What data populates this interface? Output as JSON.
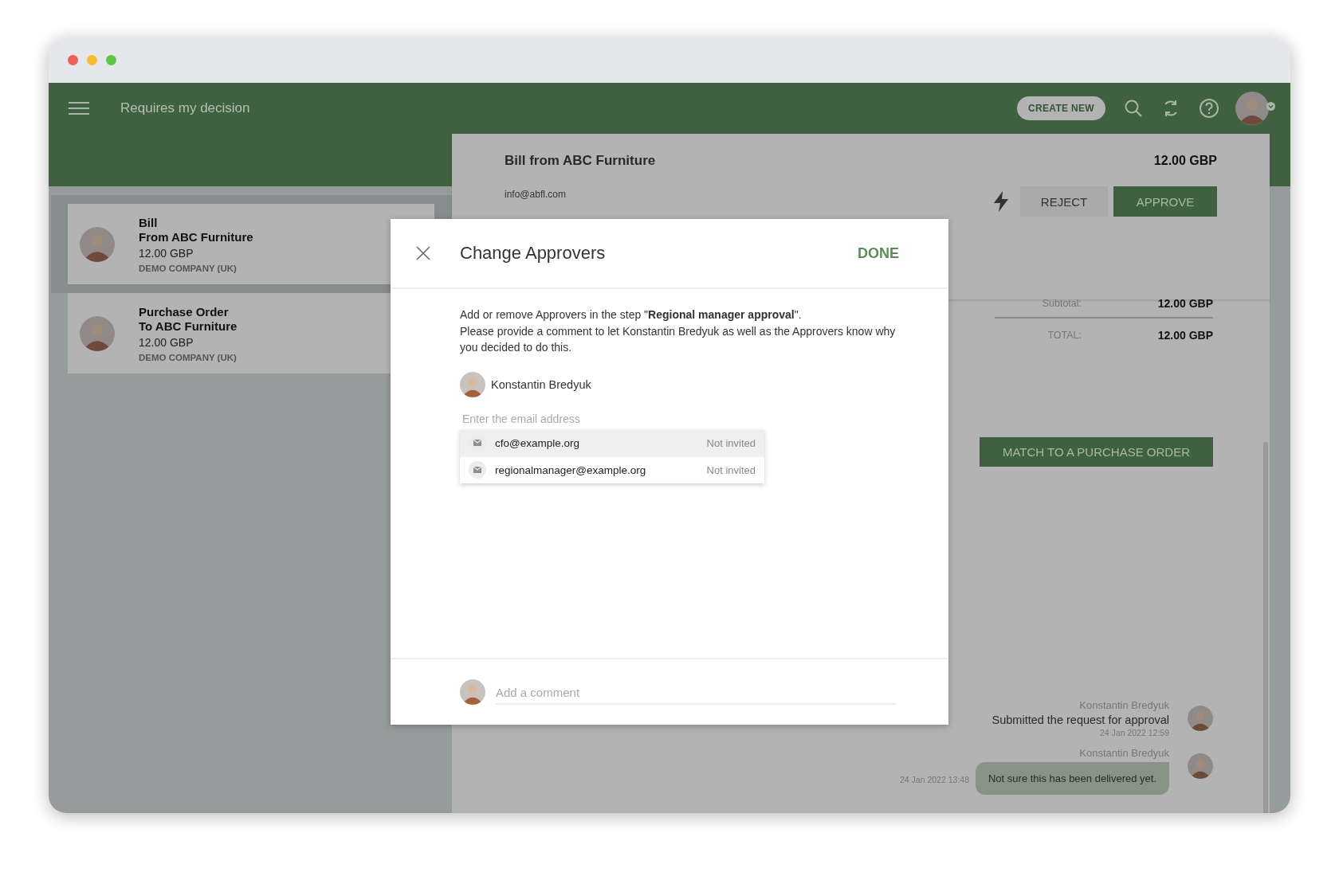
{
  "top_bar": {
    "title": "Requires my decision",
    "create_button": "CREATE NEW"
  },
  "sidebar": {
    "items": [
      {
        "type": "Bill",
        "party": "From ABC Furniture",
        "amount": "12.00 GBP",
        "company": "DEMO COMPANY (UK)",
        "selected": true
      },
      {
        "type": "Purchase Order",
        "party": "To ABC Furniture",
        "amount": "12.00 GBP",
        "company": "DEMO COMPANY (UK)",
        "selected": false
      }
    ]
  },
  "detail": {
    "title": "Bill from ABC Furniture",
    "amount": "12.00 GBP",
    "email": "info@abfl.com",
    "reject_button": "REJECT",
    "approve_button": "APPROVE",
    "totals": [
      {
        "kind": "subtotal",
        "label": "Subtotal:",
        "value": "12.00 GBP"
      },
      {
        "kind": "total",
        "label": "TOTAL:",
        "value": "12.00 GBP"
      }
    ],
    "match_button": "MATCH TO A PURCHASE ORDER",
    "activity": [
      {
        "kind": "event",
        "author": "Konstantin Bredyuk",
        "text": "Submitted the request for approval",
        "time": "24 Jan 2022 12:59"
      },
      {
        "kind": "comment",
        "author": "Konstantin Bredyuk",
        "text": "Not sure this has been delivered yet.",
        "time": "24 Jan 2022 13:48"
      }
    ]
  },
  "dialog": {
    "title": "Change Approvers",
    "done_button": "DONE",
    "message": "Add or remove Approvers in the step \"**Regional manager approval**\".\nPlease provide a comment to let Konstantin Bredyuk as well as the Approvers know why you decided to do this.",
    "requester": "Konstantin Bredyuk",
    "email_field": {
      "placeholder": "Enter the email address"
    },
    "suggestions": [
      {
        "email": "cfo@example.org",
        "status": "Not invited",
        "selected": true
      },
      {
        "email": "regionalmanager@example.org",
        "status": "Not invited",
        "selected": false
      }
    ],
    "comment_field": {
      "placeholder": "Add a comment"
    }
  }
}
